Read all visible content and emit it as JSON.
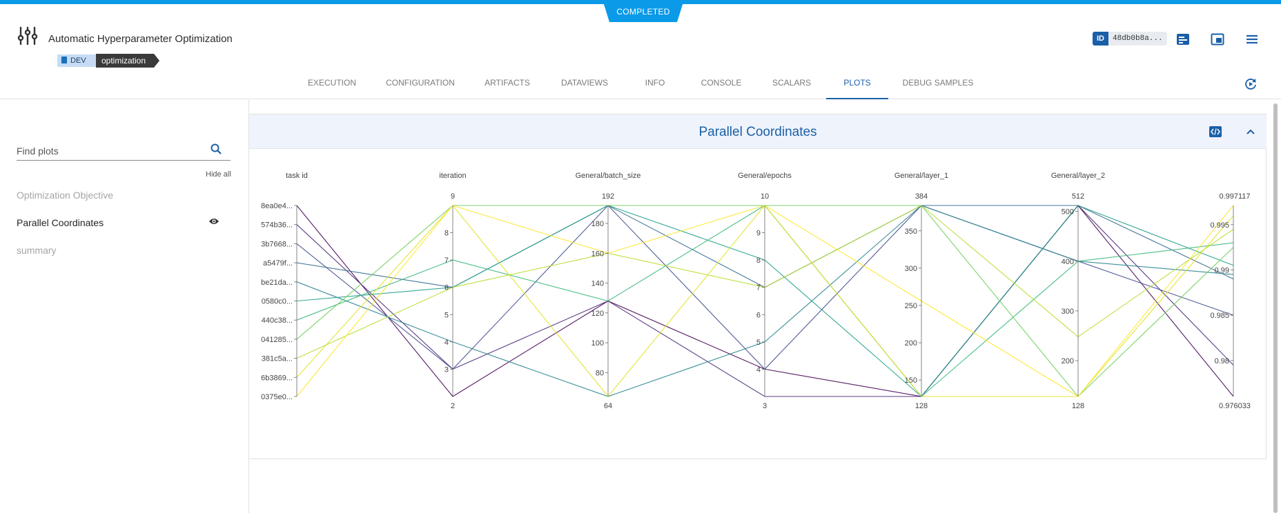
{
  "status": "COMPLETED",
  "header": {
    "title": "Automatic Hyperparameter Optimization",
    "tags": [
      "DEV",
      "optimization"
    ],
    "id_label": "ID",
    "id_value": "48db0b8a..."
  },
  "tabs": [
    "EXECUTION",
    "CONFIGURATION",
    "ARTIFACTS",
    "DATAVIEWS",
    "INFO",
    "CONSOLE",
    "SCALARS",
    "PLOTS",
    "DEBUG SAMPLES"
  ],
  "active_tab": "PLOTS",
  "sidebar": {
    "search_placeholder": "Find plots",
    "hide_all": "Hide all",
    "items": [
      {
        "label": "Optimization Objective",
        "visible": false
      },
      {
        "label": "Parallel Coordinates",
        "visible": true
      },
      {
        "label": "summary",
        "visible": false
      }
    ]
  },
  "panel": {
    "title": "Parallel Coordinates"
  },
  "colors": {
    "accent": "#1a5fa8",
    "topbar": "#0b9ae8"
  },
  "chart_data": {
    "type": "parallel_coordinates",
    "dimensions": [
      {
        "name": "task id",
        "kind": "categorical",
        "categories": [
          "8ea0e4...",
          "574b36...",
          "3b7668...",
          "a5479f...",
          "be21da...",
          "0580c0...",
          "440c38...",
          "041285...",
          "381c5a...",
          "6b3869...",
          "0375e0..."
        ]
      },
      {
        "name": "iteration",
        "range": [
          2,
          9
        ],
        "ticks": [
          2,
          3,
          4,
          5,
          6,
          7,
          8,
          9
        ],
        "tick_labels": [
          "2",
          "3",
          "4",
          "5",
          "6",
          "7",
          "8",
          "9"
        ]
      },
      {
        "name": "General/batch_size",
        "range": [
          64,
          192
        ],
        "ticks": [
          64,
          80,
          100,
          120,
          140,
          160,
          180,
          192
        ],
        "tick_labels": [
          "64",
          "80",
          "100",
          "120",
          "140",
          "160",
          "180",
          "192"
        ]
      },
      {
        "name": "General/epochs",
        "range": [
          3,
          10
        ],
        "ticks": [
          3,
          4,
          5,
          6,
          7,
          8,
          9,
          10
        ],
        "tick_labels": [
          "3",
          "4",
          "5",
          "6",
          "7",
          "8",
          "9",
          "10"
        ]
      },
      {
        "name": "General/layer_1",
        "range": [
          128,
          384
        ],
        "ticks": [
          128,
          150,
          200,
          250,
          300,
          350,
          384
        ],
        "tick_labels": [
          "128",
          "150",
          "200",
          "250",
          "300",
          "350",
          "384"
        ]
      },
      {
        "name": "General/layer_2",
        "range": [
          128,
          512
        ],
        "ticks": [
          128,
          200,
          300,
          400,
          500,
          512
        ],
        "tick_labels": [
          "128",
          "200",
          "300",
          "400",
          "500",
          "512"
        ]
      },
      {
        "name": "",
        "range": [
          0.976033,
          0.997117
        ],
        "ticks": [
          0.976033,
          0.98,
          0.985,
          0.99,
          0.995,
          0.997117
        ],
        "tick_labels": [
          "0.976033",
          "0.98",
          "0.985",
          "0.99",
          "0.995",
          "0.997117"
        ]
      }
    ],
    "colorscale": [
      "#440154",
      "#3b528b",
      "#21918c",
      "#5ec962",
      "#fde725"
    ],
    "lines": [
      {
        "values": [
          0,
          2,
          128,
          4,
          128,
          512,
          0.976033
        ],
        "color": "#440154"
      },
      {
        "values": [
          1,
          3,
          128,
          3,
          128,
          512,
          0.9795
        ],
        "color": "#482878"
      },
      {
        "values": [
          2,
          3,
          192,
          4,
          384,
          400,
          0.985
        ],
        "color": "#3e4a89"
      },
      {
        "values": [
          3,
          6,
          192,
          7,
          384,
          512,
          0.989
        ],
        "color": "#31688e"
      },
      {
        "values": [
          4,
          4,
          64,
          5,
          384,
          400,
          0.9895
        ],
        "color": "#26828e"
      },
      {
        "values": [
          5,
          6,
          192,
          8,
          128,
          512,
          0.9905
        ],
        "color": "#1f9e89"
      },
      {
        "values": [
          6,
          7,
          128,
          10,
          128,
          400,
          0.993
        ],
        "color": "#35b779"
      },
      {
        "values": [
          7,
          9,
          192,
          10,
          384,
          128,
          0.9925
        ],
        "color": "#6ece58"
      },
      {
        "values": [
          8,
          6,
          160,
          7,
          384,
          248,
          0.9945
        ],
        "color": "#b5de2b"
      },
      {
        "values": [
          9,
          9,
          64,
          10,
          128,
          128,
          0.996
        ],
        "color": "#e0e224"
      },
      {
        "values": [
          10,
          9,
          160,
          10,
          256,
          128,
          0.997117
        ],
        "color": "#fde725"
      }
    ]
  }
}
